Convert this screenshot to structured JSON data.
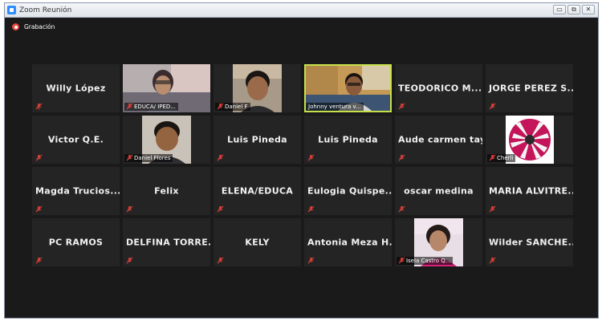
{
  "window": {
    "title": "Zoom Reunión"
  },
  "window_controls": {
    "minimize": "▭",
    "restore": "⧉",
    "close": "✕"
  },
  "recording": {
    "label": "Grabación"
  },
  "colors": {
    "background": "#1a1a1a",
    "tile": "#242424",
    "active_speaker": "#c6e04a",
    "muted_mic": "#e0413a"
  },
  "participants": [
    {
      "name": "Willy López",
      "video": false,
      "muted": true
    },
    {
      "name": "EDUCA/ IPED...",
      "video": true,
      "muted": true
    },
    {
      "name": "Daniel F",
      "video": true,
      "muted": true
    },
    {
      "name": "Johnny ventura v...",
      "video": true,
      "muted": false,
      "active": true
    },
    {
      "name": "TEODORICO M...",
      "video": false,
      "muted": true
    },
    {
      "name": "JORGE PEREZ S...",
      "video": false,
      "muted": true
    },
    {
      "name": "Victor Q.E.",
      "video": false,
      "muted": true
    },
    {
      "name": "Daniel Flores",
      "video": true,
      "muted": true
    },
    {
      "name": "Luis Pineda",
      "video": false,
      "muted": true
    },
    {
      "name": "Luis Pineda",
      "video": false,
      "muted": true
    },
    {
      "name": "Aude carmen taya",
      "video": false,
      "muted": true
    },
    {
      "name": "Cherli",
      "video": true,
      "muted": true
    },
    {
      "name": "Magda Trucios...",
      "video": false,
      "muted": true
    },
    {
      "name": "Felix",
      "video": false,
      "muted": true
    },
    {
      "name": "ELENA/EDUCA",
      "video": false,
      "muted": true
    },
    {
      "name": "Eulogia Quispe...",
      "video": false,
      "muted": true
    },
    {
      "name": "oscar medina",
      "video": false,
      "muted": true
    },
    {
      "name": "MARIA ALVITRE...",
      "video": false,
      "muted": true
    },
    {
      "name": "PC RAMOS",
      "video": false,
      "muted": true
    },
    {
      "name": "DELFINA TORRE...",
      "video": false,
      "muted": true
    },
    {
      "name": "KELY",
      "video": false,
      "muted": true
    },
    {
      "name": "Antonia Meza H...",
      "video": false,
      "muted": true
    },
    {
      "name": "Isela Castro Q...",
      "video": true,
      "muted": true
    },
    {
      "name": "Wilder SANCHE...",
      "video": false,
      "muted": true
    }
  ]
}
